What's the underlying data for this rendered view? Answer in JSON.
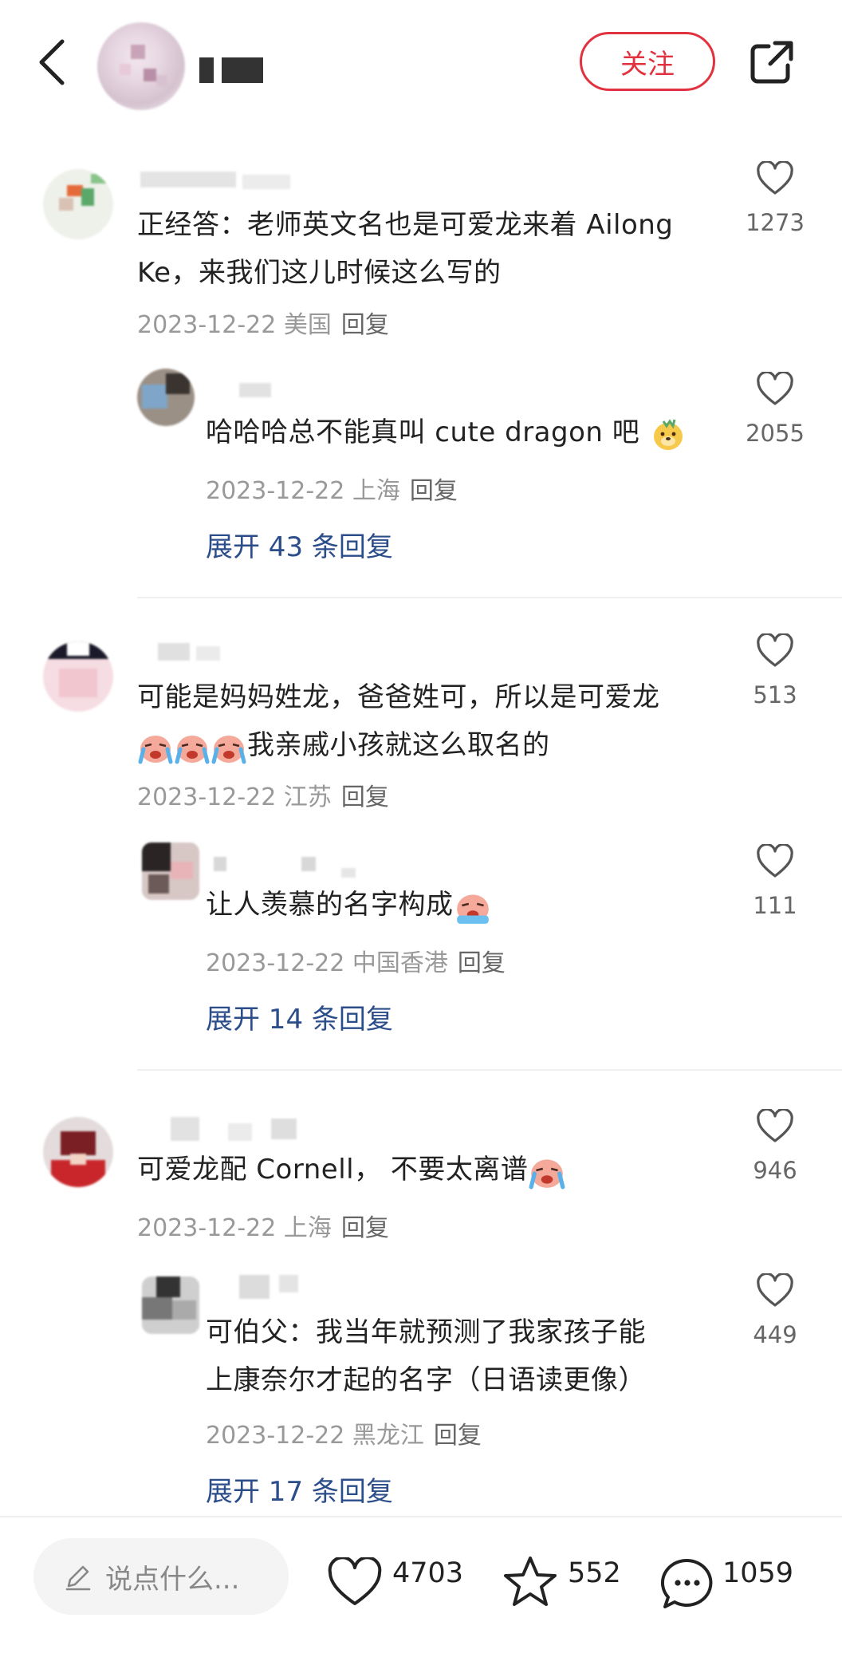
{
  "header": {
    "follow_label": "关注"
  },
  "comments": [
    {
      "text_line1": "正经答：老师英文名也是可爱龙来着 Ailong",
      "text_line2": "Ke，来我们这儿时候这么写的",
      "date": "2023-12-22",
      "location": "美国",
      "reply_label": "回复",
      "likes": "1273",
      "sub": {
        "text": "哈哈哈总不能真叫 cute dragon 吧",
        "date": "2023-12-22",
        "location": "上海",
        "reply_label": "回复",
        "likes": "2055"
      },
      "expand_label": "展开 43 条回复"
    },
    {
      "text_line1": "可能是妈妈姓龙，爸爸姓可，所以是可爱龙",
      "text_line2": "我亲戚小孩就这么取名的",
      "date": "2023-12-22",
      "location": "江苏",
      "reply_label": "回复",
      "likes": "513",
      "sub": {
        "text": "让人羡慕的名字构成",
        "date": "2023-12-22",
        "location": "中国香港",
        "reply_label": "回复",
        "likes": "111"
      },
      "expand_label": "展开 14 条回复"
    },
    {
      "text_line1": "可爱龙配 Cornell， 不要太离谱",
      "date": "2023-12-22",
      "location": "上海",
      "reply_label": "回复",
      "likes": "946",
      "sub": {
        "text_line1": "可伯父：我当年就预测了我家孩子能",
        "text_line2": "上康奈尔才起的名字（日语读更像）",
        "date": "2023-12-22",
        "location": "黑龙江",
        "reply_label": "回复",
        "likes": "449"
      },
      "expand_label": "展开 17 条回复"
    }
  ],
  "bottom_bar": {
    "input_placeholder": "说点什么...",
    "likes": "4703",
    "favorites": "552",
    "comments": "1059"
  },
  "colors": {
    "accent": "#e2323f",
    "link": "#2b4d8a",
    "meta": "#999999"
  },
  "icons": [
    "back-icon",
    "share-icon",
    "heart-icon",
    "star-icon",
    "comment-icon",
    "pencil-icon",
    "crying-emoji-icon",
    "dog-emoji-icon"
  ]
}
